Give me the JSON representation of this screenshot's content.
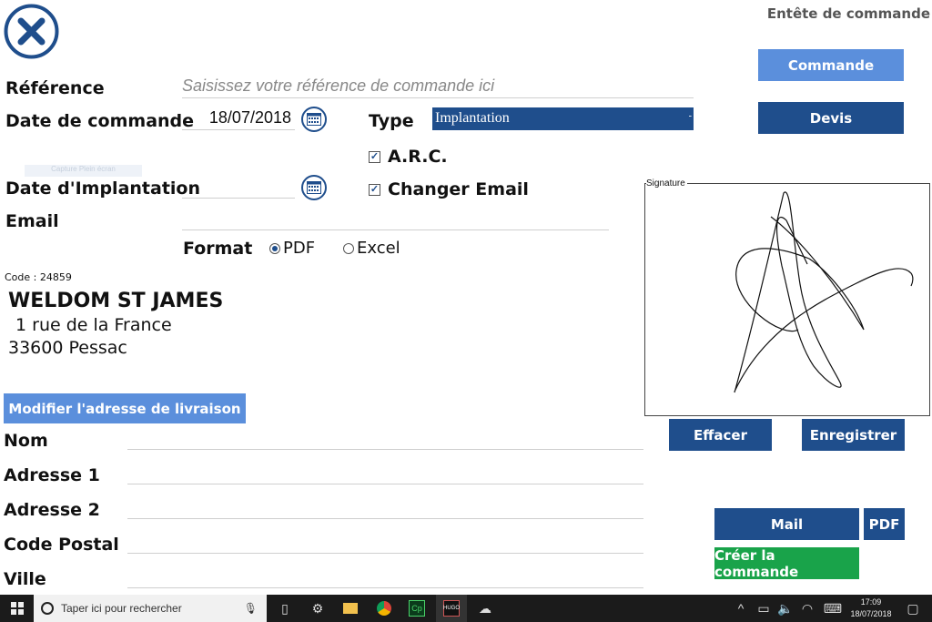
{
  "header": {
    "title": "Entête de commande"
  },
  "order": {
    "reference_label": "Référence",
    "reference_placeholder": "Saisissez votre référence de commande ici",
    "date_label": "Date de commande",
    "date_value": "18/07/2018",
    "type_label": "Type",
    "type_value": "Implantation",
    "arc_label": "A.R.C.",
    "arc_checked": true,
    "change_email_label": "Changer Email",
    "change_email_checked": true,
    "implantation_date_label": "Date d'Implantation",
    "implantation_date_value": "",
    "email_label": "Email",
    "email_value": "",
    "format_label": "Format",
    "format_options": [
      "PDF",
      "Excel"
    ],
    "format_selected": "PDF",
    "faint_tooltip": "Capture Plein écran"
  },
  "customer": {
    "code": "Code : 24859",
    "name": "WELDOM ST JAMES",
    "address_line1": "1 rue de la France",
    "address_line2": "33600 Pessac"
  },
  "delivery": {
    "modify_button": "Modifier l'adresse de livraison",
    "fields": [
      {
        "label": "Nom",
        "value": ""
      },
      {
        "label": "Adresse 1",
        "value": ""
      },
      {
        "label": "Adresse 2",
        "value": ""
      },
      {
        "label": "Code Postal",
        "value": ""
      },
      {
        "label": "Ville",
        "value": ""
      }
    ]
  },
  "actions": {
    "commande": "Commande",
    "devis": "Devis",
    "effacer": "Effacer",
    "enregistrer": "Enregistrer",
    "mail": "Mail",
    "pdf": "PDF",
    "creer": "Créer la commande"
  },
  "signature": {
    "label": "Signature"
  },
  "taskbar": {
    "search_placeholder": "Taper ici pour rechercher",
    "time": "17:09",
    "date": "18/07/2018"
  },
  "colors": {
    "primary": "#1f4e8c",
    "light": "#5b8fdc",
    "green": "#19a34a"
  }
}
